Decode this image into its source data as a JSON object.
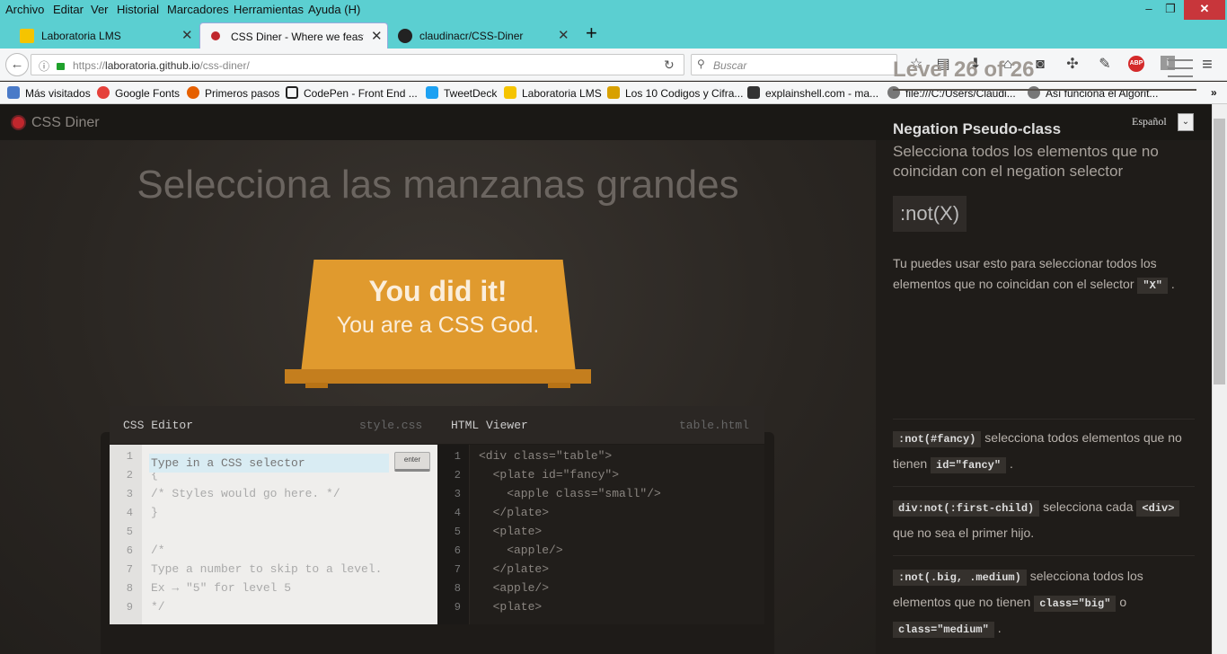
{
  "menubar": {
    "items": [
      "Archivo",
      "Editar",
      "Ver",
      "Historial",
      "Marcadores",
      "Herramientas",
      "Ayuda (H)"
    ]
  },
  "tabs": [
    {
      "label": "Laboratoria LMS",
      "icon": "laboratoria-icon",
      "color": "#f5c400"
    },
    {
      "label": "CSS Diner - Where we feast on CSS",
      "icon": "css-diner-icon",
      "color": "#c0272d"
    },
    {
      "label": "claudinacr/CSS-Diner",
      "icon": "github-icon",
      "color": "#222222"
    }
  ],
  "nav": {
    "url_prefix": "https://",
    "url_host": "laboratoria.github.io",
    "url_path": "/css-diner/",
    "search_placeholder": "Buscar"
  },
  "bookmarks": [
    {
      "label": "Más visitados",
      "color": "#4a7ac8"
    },
    {
      "label": "Google Fonts",
      "color": "#e5403a"
    },
    {
      "label": "Primeros pasos",
      "color": "#e66000"
    },
    {
      "label": "CodePen - Front End ...",
      "color": "#222222"
    },
    {
      "label": "TweetDeck",
      "color": "#1da1f2"
    },
    {
      "label": "Laboratoria LMS",
      "color": "#f5c400"
    },
    {
      "label": "Los 10 Codigos y Cifra...",
      "color": "#d8a000"
    },
    {
      "label": "explainshell.com - ma...",
      "color": "#333333"
    },
    {
      "label": "file:///C:/Users/Claudi...",
      "color": "#777777"
    },
    {
      "label": "Así funciona el Algorit...",
      "color": "#777777"
    }
  ],
  "page": {
    "logo": "CSS Diner",
    "language": "Español",
    "order": "Selecciona las manzanas grandes",
    "win_title": "You did it!",
    "win_subtitle": "You are a CSS God.",
    "css_editor": {
      "title": "CSS Editor",
      "file": "style.css",
      "input_placeholder": "Type in a CSS selector",
      "enter_label": "enter",
      "lines": [
        "",
        "{",
        "/* Styles would go here. */",
        "}",
        "",
        "/*",
        "Type a number to skip to a level.",
        "Ex → \"5\" for level 5",
        "*/"
      ]
    },
    "html_viewer": {
      "title": "HTML Viewer",
      "file": "table.html",
      "lines": [
        "<div class=\"table\">",
        "  <plate id=\"fancy\">",
        "    <apple class=\"small\"/>",
        "  </plate>",
        "  <plate>",
        "    <apple/>",
        "  </plate>",
        "  <apple/>",
        "  <plate>"
      ]
    }
  },
  "sidebar": {
    "level": "Level 26 of 26",
    "selector_name": "Negation Pseudo-class",
    "title": "Selecciona todos los elementos que no coincidan con el negation selector",
    "syntax": ":not(X)",
    "hint_text": "Tu puedes usar esto para seleccionar todos los elementos que no coincidan con el selector",
    "hint_code": "\"X\"",
    "examples": [
      {
        "code1": ":not(#fancy)",
        "text1": " selecciona todos elementos que no tienen ",
        "code2": "id=\"fancy\"",
        "text2": " ."
      },
      {
        "code1": "div:not(:first-child)",
        "text1": " selecciona cada ",
        "code2": "<div>",
        "text2": " que no sea el primer hijo."
      },
      {
        "code1": ":not(.big, .medium)",
        "text1": " selecciona todos los elementos que no tienen ",
        "code2": "class=\"big\"",
        "text2": " o ",
        "code3": "class=\"medium\"",
        "text3": " ."
      }
    ]
  }
}
